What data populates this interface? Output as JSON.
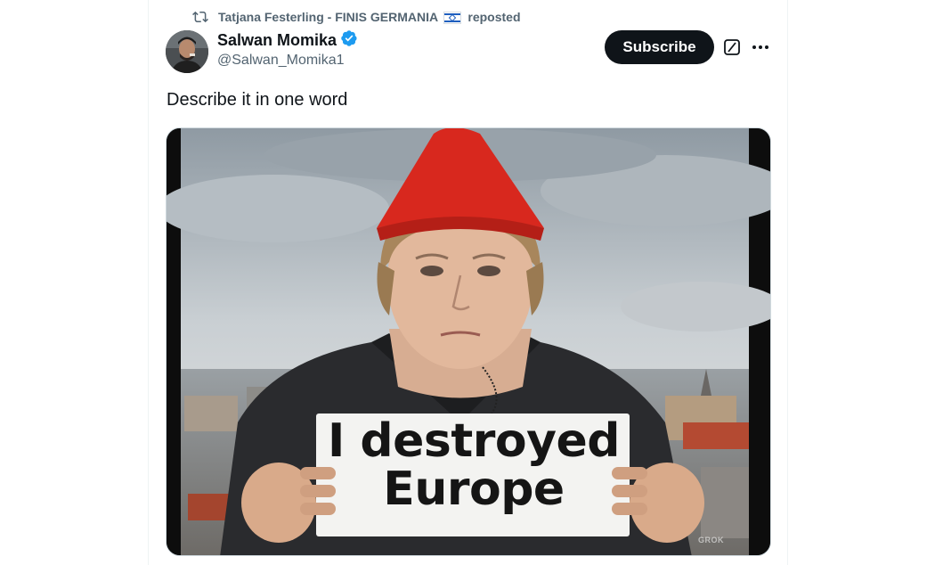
{
  "repost": {
    "icon": "repost-icon",
    "user": "Tatjana Festerling - FINIS GERMANIA",
    "flag_icon": "israel-flag-icon",
    "suffix": "reposted"
  },
  "post": {
    "author_name": "Salwan Momika",
    "verified_icon": "verified-badge-icon",
    "handle": "@Salwan_Momika1",
    "subscribe_label": "Subscribe",
    "text": "Describe it in one word",
    "image": {
      "sign_line1": "I destroyed",
      "sign_line2": "Europe",
      "watermark": "GROK"
    }
  },
  "colors": {
    "text_primary": "#0f1419",
    "text_secondary": "#536471",
    "verified_blue": "#1d9bf0",
    "hat_red": "#d8281e",
    "button_dark": "#0f1419"
  }
}
